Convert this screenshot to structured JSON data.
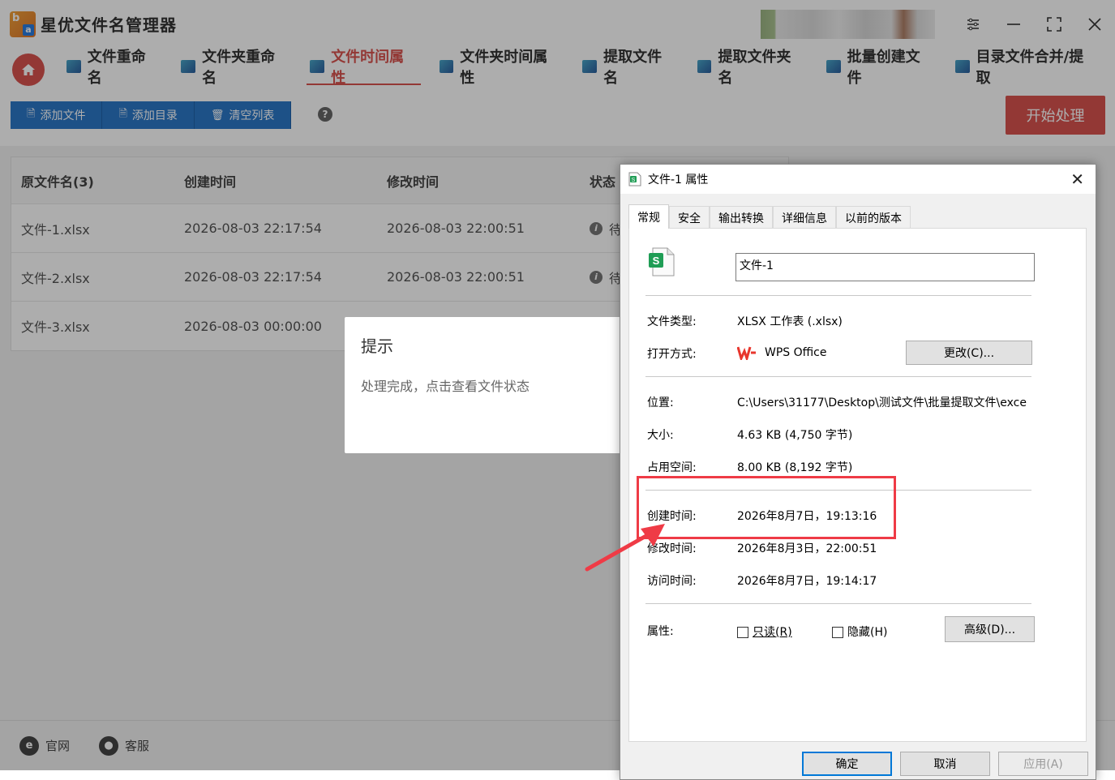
{
  "app": {
    "title": "星优文件名管理器",
    "logo_letters": {
      "top": "b",
      "bottom": "a"
    }
  },
  "nav": {
    "tabs": [
      {
        "label": "文件重命名",
        "icon": "rename-icon"
      },
      {
        "label": "文件夹重命名",
        "icon": "folder-rename-icon"
      },
      {
        "label": "文件时间属性",
        "icon": "file-time-icon",
        "active": true
      },
      {
        "label": "文件夹时间属性",
        "icon": "folder-time-icon"
      },
      {
        "label": "提取文件名",
        "icon": "extract-file-icon"
      },
      {
        "label": "提取文件夹名",
        "icon": "extract-folder-icon"
      },
      {
        "label": "批量创建文件",
        "icon": "batch-create-icon"
      },
      {
        "label": "目录文件合并/提取",
        "icon": "merge-icon"
      }
    ]
  },
  "toolbar": {
    "add_file": "添加文件",
    "add_dir": "添加目录",
    "clear_list": "清空列表",
    "help": "?",
    "start": "开始处理"
  },
  "table": {
    "headers": [
      "原文件名(3)",
      "创建时间",
      "修改时间",
      "状态"
    ],
    "rows": [
      {
        "name": "文件-1.xlsx",
        "created": "2026-08-03 22:17:54",
        "modified": "2026-08-03 22:00:51",
        "status": "待"
      },
      {
        "name": "文件-2.xlsx",
        "created": "2026-08-03 22:17:54",
        "modified": "2026-08-03 22:00:51",
        "status": "待"
      },
      {
        "name": "文件-3.xlsx",
        "created": "2026-08-03 00:00:00",
        "modified": "",
        "status": ""
      }
    ]
  },
  "toast": {
    "title": "提示",
    "message": "处理完成，点击查看文件状态"
  },
  "footer": {
    "site": "官网",
    "service": "客服"
  },
  "dialog": {
    "title": "文件-1 属性",
    "tabs": [
      "常规",
      "安全",
      "输出转换",
      "详细信息",
      "以前的版本"
    ],
    "file_name": "文件-1",
    "file_icon_letter": "S",
    "labels": {
      "type": "文件类型:",
      "open_with": "打开方式:",
      "location": "位置:",
      "size": "大小:",
      "size_on_disk": "占用空间:",
      "created": "创建时间:",
      "modified": "修改时间:",
      "accessed": "访问时间:",
      "attributes": "属性:"
    },
    "values": {
      "type": "XLSX 工作表 (.xlsx)",
      "open_with": "WPS Office",
      "location": "C:\\Users\\31177\\Desktop\\测试文件\\批量提取文件\\exce",
      "size": "4.63 KB (4,750 字节)",
      "size_on_disk": "8.00 KB (8,192 字节)",
      "created": "2026年8月7日，19:13:16",
      "modified": "2026年8月3日，22:00:51",
      "accessed": "2026年8月7日，19:14:17"
    },
    "change_button": "更改(C)...",
    "readonly": "只读(R)",
    "hidden": "隐藏(H)",
    "advanced": "高级(D)...",
    "ok": "确定",
    "cancel": "取消",
    "apply": "应用(A)"
  },
  "colors": {
    "accent_red": "#d9534f",
    "toolbar_blue": "#2c78c8",
    "highlight_red": "#ef3b46",
    "win_blue": "#0078d7"
  }
}
